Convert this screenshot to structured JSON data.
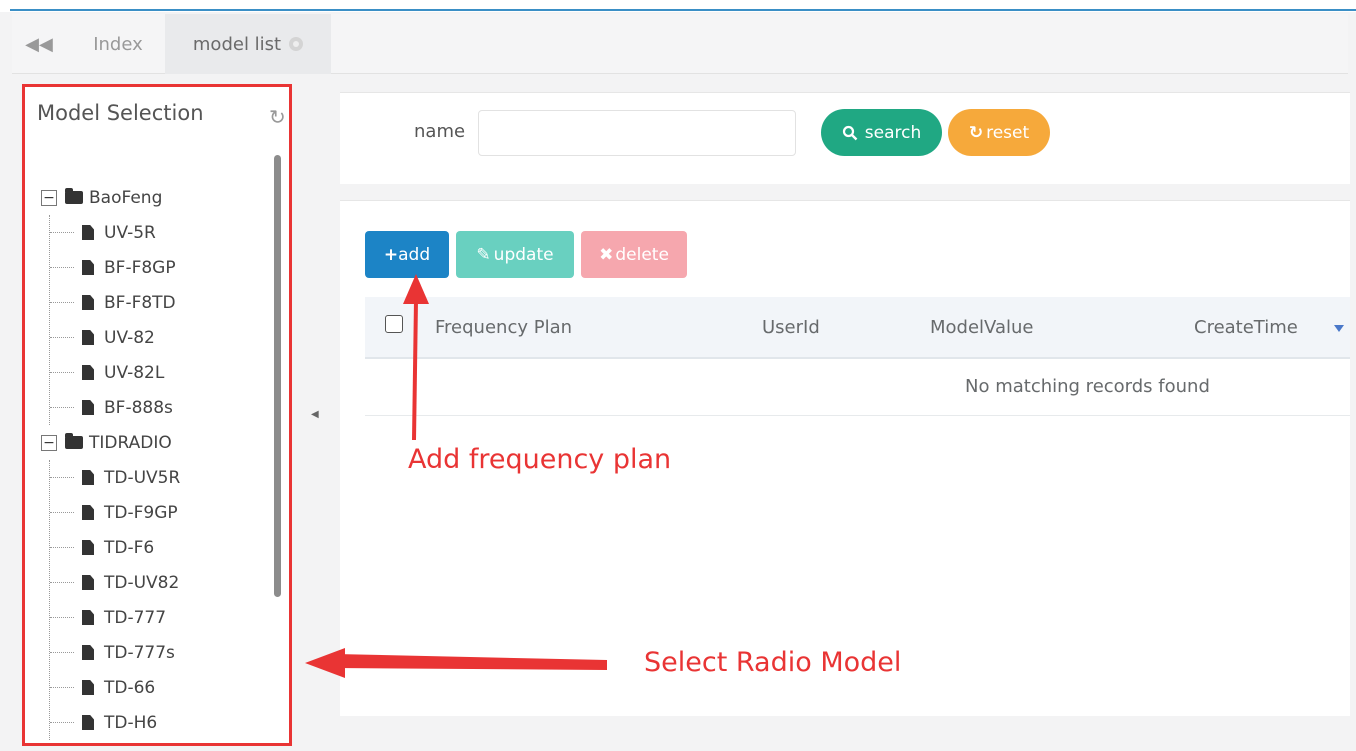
{
  "tabs": {
    "index": "Index",
    "model_list": "model list"
  },
  "model_panel": {
    "title": "Model Selection",
    "groups": [
      {
        "label": "BaoFeng",
        "children": [
          "UV-5R",
          "BF-F8GP",
          "BF-F8TD",
          "UV-82",
          "UV-82L",
          "BF-888s"
        ]
      },
      {
        "label": "TIDRADIO",
        "children": [
          "TD-UV5R",
          "TD-F9GP",
          "TD-F6",
          "TD-UV82",
          "TD-777",
          "TD-777s",
          "TD-66",
          "TD-H6"
        ]
      }
    ]
  },
  "search": {
    "label": "name",
    "value": "",
    "placeholder": "",
    "search_button": "search",
    "reset_button": "reset"
  },
  "toolbar": {
    "add_label": "add",
    "update_label": "update",
    "delete_label": "delete"
  },
  "table": {
    "columns": [
      "Frequency Plan",
      "UserId",
      "ModelValue",
      "CreateTime"
    ],
    "empty_message": "No matching records found"
  },
  "annotations": {
    "add_hint": "Add frequency plan",
    "select_hint": "Select Radio Model"
  },
  "colors": {
    "accent_blue": "#1c84c6",
    "search_green": "#20a883",
    "reset_orange": "#f6a93b",
    "update_teal": "#69d0c0",
    "delete_pink": "#f6a7ae",
    "annotation_red": "#e93434"
  }
}
